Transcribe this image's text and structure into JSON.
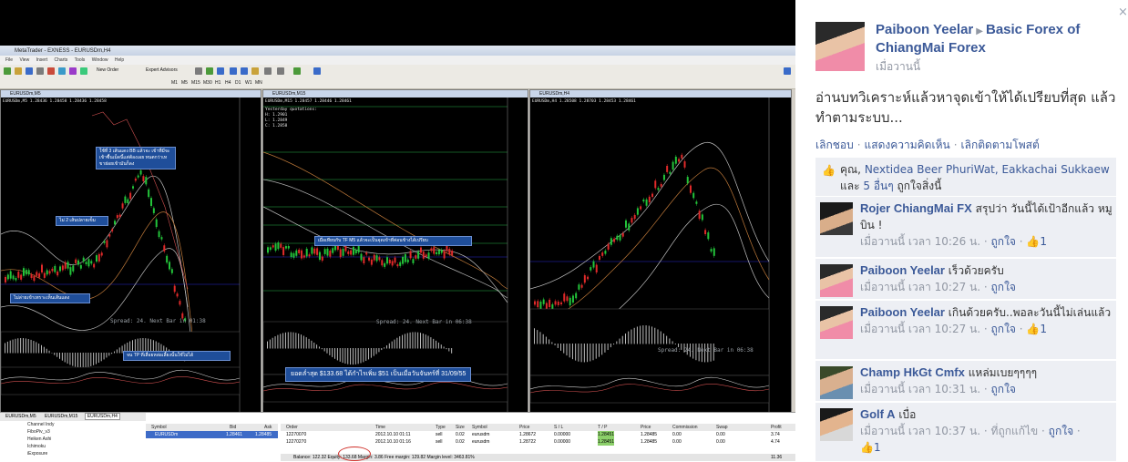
{
  "photo": {
    "window_title": "MetaTrader - EXNESS - EURUSDm,H4",
    "menu": [
      "File",
      "View",
      "Insert",
      "Charts",
      "Tools",
      "Window",
      "Help"
    ],
    "toolbar": {
      "new_order": "New Order",
      "expert_advisors": "Expert Advisors"
    },
    "timeframes": [
      "M1",
      "M5",
      "M15",
      "M30",
      "H1",
      "H4",
      "D1",
      "W1",
      "MN"
    ],
    "charts": [
      {
        "title": "EURUSDm,M5",
        "info": "EURUSDm,M5  1.28436  1.28458  1.28436  1.28458",
        "spread": "Spread: 24. Next Bar in 01:38",
        "callouts": [
          "ใช้ที่ 3 เส้นแดง BB แล้วจะ เข้าที่มีจะเข้าซื้นเม็ดนี้แต่ต้องเอย ทนตกว่าเทขาย่อยเข้ามันก็ลง",
          "ไม่ 2 เส้นปลายเข็ม",
          "ไม่ล่ายเข้าเทราะเห็นเส้นแดง",
          "จน TP ที่เลื่อยหล่อเลี้ยงนั้นใช้ไม่ได้"
        ]
      },
      {
        "title": "EURUSDm,M15",
        "info": "EURUSDm,M15  1.28457  1.28446  1.28461",
        "quotes": [
          "Yesterday quotations:",
          "H: 1.2901",
          "L: 1.2849",
          "C: 1.2858"
        ],
        "spread": "Spread: 24. Next Bar in 06:38",
        "callouts": [
          "เมื่อเทียบกับ TF M5 แล้วจะเป็นจุดเข้าที่ค่อนข้างได้เปรียบ"
        ]
      },
      {
        "title": "EURUSDm,H4",
        "info": "EURUSDm,H4  1.28508  1.28703  1.28453  1.28461",
        "spread": "Spread: 24. Next Bar in 06:38"
      }
    ],
    "bottom_tabs": [
      "EURUSDm,M5",
      "EURUSDm,M15",
      "EURUSDm,H4"
    ],
    "navigator": [
      "Channel Indy",
      "FiboPiv_v3",
      "Heiken Ashi",
      "Ichimoku",
      "iExposure"
    ],
    "market_watch": {
      "headers": [
        "Symbol",
        "Bid",
        "Ask"
      ],
      "rows": [
        [
          "EURUSDm",
          "1.28461",
          "1.28485"
        ]
      ]
    },
    "terminal": {
      "banner": "ยอดล่ำสุด $133.68 ได้กำไรเพิ่ม $51 เป็นเมื่อวันจันทร์ที่ 31/09/55",
      "headers": [
        "Order",
        "Time",
        "Type",
        "Size",
        "Symbol",
        "Price",
        "S / L",
        "T / P",
        "Price",
        "Commission",
        "Swap",
        "Profit"
      ],
      "rows": [
        [
          "12270070",
          "2012.10.10 01:11",
          "sell",
          "0.02",
          "eurusdm",
          "1.28672",
          "0.00000",
          "1.28451",
          "1.28485",
          "0.00",
          "0.00",
          "3.74"
        ],
        [
          "12270270",
          "2012.10.10 01:16",
          "sell",
          "0.02",
          "eurusdm",
          "1.28722",
          "0.00000",
          "1.28451",
          "1.28485",
          "0.00",
          "0.00",
          "4.74"
        ]
      ],
      "balance": "Balance: 122.32  Equity: 133.68  Margin: 3.86  Free margin: 129.82  Margin level: 3463.81%",
      "total": "11.36"
    }
  },
  "panel": {
    "close_glyph": "×",
    "poster": {
      "name": "Paiboon Yeelar",
      "arrow": "▶",
      "group": "Basic Forex of ChiangMai Forex",
      "time": "เมื่อวานนี้"
    },
    "post_text": "อ่านบทวิเคราะห์แล้วหาจุดเข้าให้ได้เปรียบที่สุด แล้วทำตามระบบ...",
    "actions": [
      "เลิกชอบ",
      "แสดงความคิดเห็น",
      "เลิกติดตามโพสต์"
    ],
    "likes": {
      "prefix": "คุณ,",
      "names": "Nextidea Beer PhuriWat, Eakkachai Sukkaew",
      "and": "และ",
      "others": "5 อื่นๆ",
      "suffix": "ถูกใจสิ่งนี้"
    },
    "comments": [
      {
        "name": "Rojer ChiangMai FX",
        "text": "สรุปว่า วันนี้ได้เป้าอีกแล้ว หมูบิน !",
        "time": "เมื่อวานนี้ เวลา 10:26 น.",
        "like": "ถูกใจ",
        "likes": "1"
      },
      {
        "name": "Paiboon Yeelar",
        "text": "เร็วด้วยครับ",
        "time": "เมื่อวานนี้ เวลา 10:27 น.",
        "like": "ถูกใจ",
        "likes": ""
      },
      {
        "name": "Paiboon Yeelar",
        "text": "เกินด้วยครับ..พอละวันนี้ไม่เล่นแล้ว",
        "time": "เมื่อวานนี้ เวลา 10:27 น.",
        "like": "ถูกใจ",
        "likes": "1"
      },
      {
        "name": "Champ HkGt Cmfx",
        "text": "แหล่มเบยๆๆๆๆ",
        "time": "เมื่อวานนี้ เวลา 10:31 น.",
        "like": "ถูกใจ",
        "likes": ""
      },
      {
        "name": "Golf A",
        "text": "เบื่อ",
        "time": "เมื่อวานนี้ เวลา 10:37 น.",
        "edited": "ที่ถูกแก้ไข",
        "like": "ถูกใจ",
        "likes": "1"
      }
    ],
    "colors": {
      "link": "#3b5998",
      "muted": "#9197a3",
      "box_bg": "#edeff4"
    }
  }
}
